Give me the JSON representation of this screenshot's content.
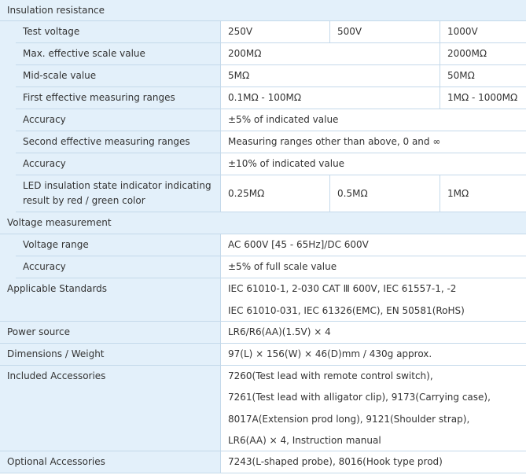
{
  "insulation": {
    "title": "Insulation resistance",
    "test_voltage": {
      "label": "Test voltage",
      "v250": "250V",
      "v500": "500V",
      "v1000": "1000V"
    },
    "max_scale": {
      "label": "Max. effective scale value",
      "a": "200MΩ",
      "b": "2000MΩ"
    },
    "mid_scale": {
      "label": "Mid-scale value",
      "a": "5MΩ",
      "b": "50MΩ"
    },
    "first_ranges": {
      "label": "First effective measuring ranges",
      "a": "0.1MΩ - 100MΩ",
      "b": "1MΩ - 1000MΩ"
    },
    "accuracy1": {
      "label": "Accuracy",
      "value": "±5% of indicated value"
    },
    "second_ranges": {
      "label": "Second effective measuring ranges",
      "value": "Measuring ranges other than above, 0 and ∞"
    },
    "accuracy2": {
      "label": "Accuracy",
      "value": "±10% of indicated value"
    },
    "led": {
      "label": "LED insulation state indicator indicating result by red / green color",
      "v250": "0.25MΩ",
      "v500": "0.5MΩ",
      "v1000": "1MΩ"
    }
  },
  "voltage": {
    "title": "Voltage measurement",
    "range": {
      "label": "Voltage range",
      "value": "AC 600V [45 - 65Hz]/DC 600V"
    },
    "accuracy": {
      "label": "Accuracy",
      "value": "±5% of full scale value"
    }
  },
  "standards": {
    "label": "Applicable Standards",
    "lines": [
      "IEC 61010-1, 2-030 CAT Ⅲ 600V, IEC 61557-1, -2",
      "IEC 61010-031, IEC 61326(EMC), EN 50581(RoHS)"
    ]
  },
  "power": {
    "label": "Power source",
    "value": "LR6/R6(AA)(1.5V) × 4"
  },
  "dimensions": {
    "label": "Dimensions / Weight",
    "value": "97(L) × 156(W) × 46(D)mm / 430g approx."
  },
  "included": {
    "label": "Included Accessories",
    "lines": [
      "7260(Test lead with remote control switch),",
      "7261(Test lead with alligator clip), 9173(Carrying case),",
      "8017A(Extension prod long), 9121(Shoulder strap),",
      "LR6(AA) × 4, Instruction manual"
    ]
  },
  "optional": {
    "label": "Optional Accessories",
    "value": "7243(L-shaped probe), 8016(Hook type prod)"
  }
}
